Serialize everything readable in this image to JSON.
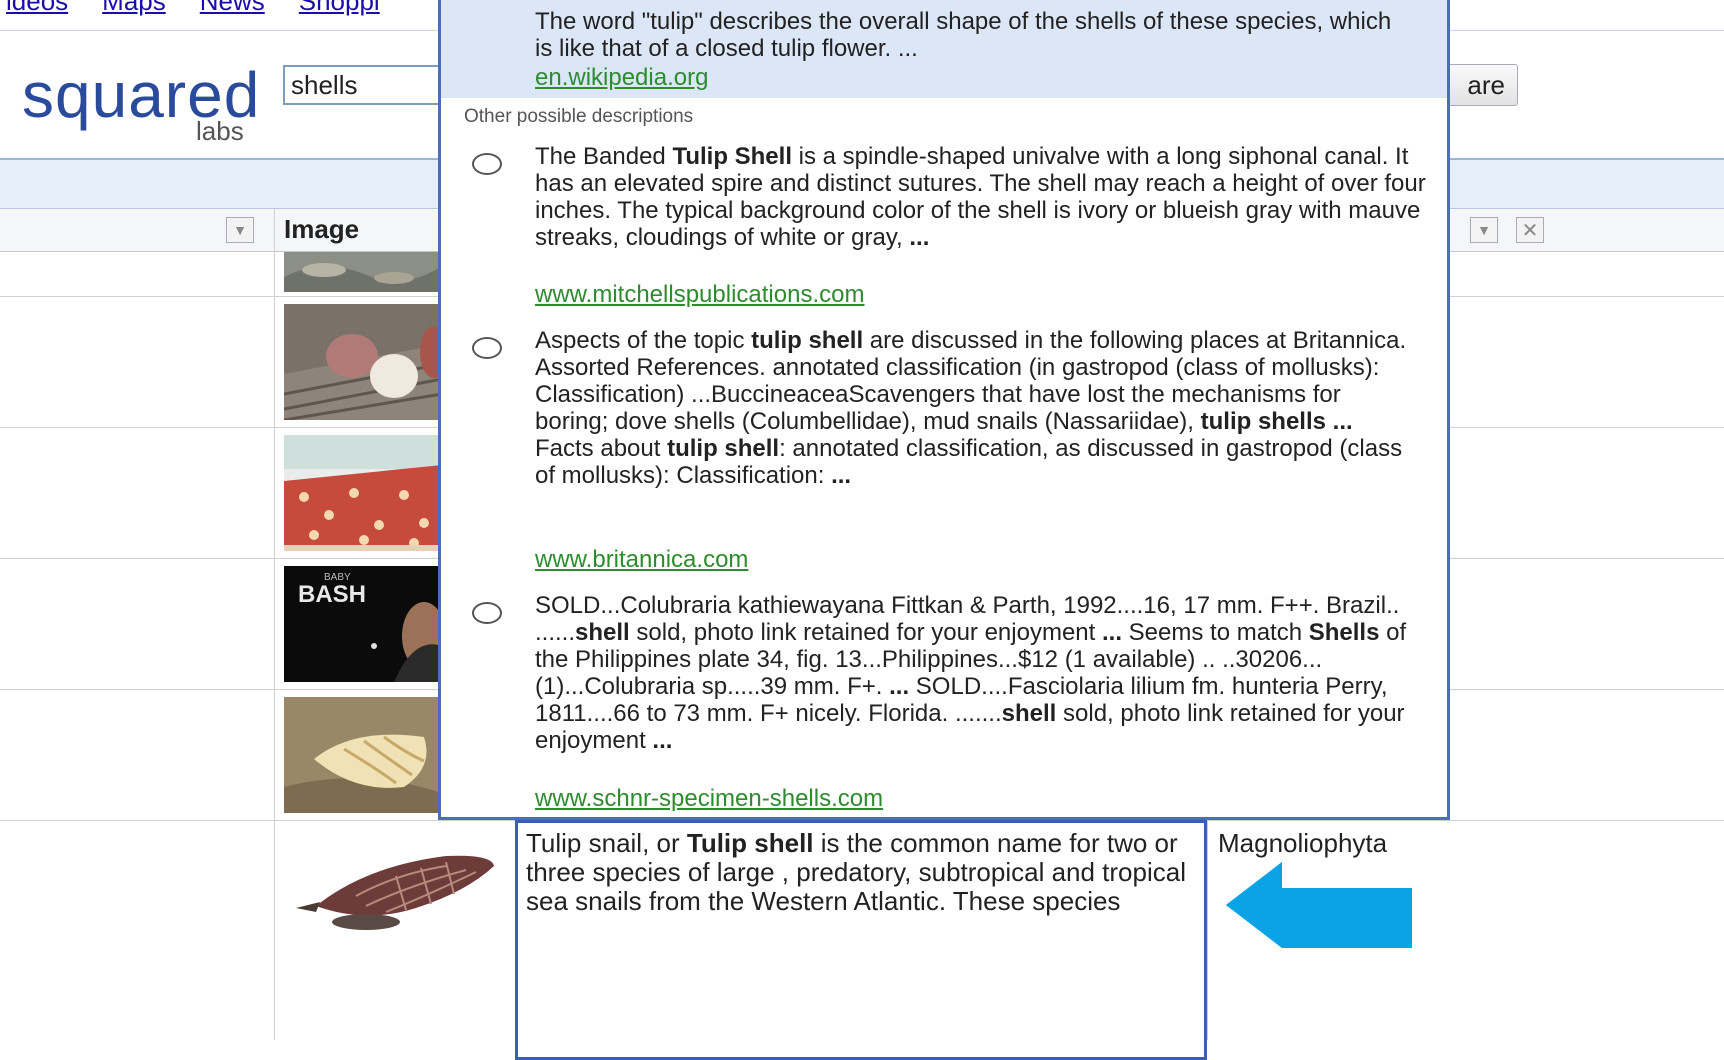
{
  "nav": {
    "links": [
      "ideos",
      "Maps",
      "News",
      "Shoppi"
    ]
  },
  "logo": {
    "main": "squared",
    "sub": "labs"
  },
  "search": {
    "value": "shells",
    "compare_label": "are"
  },
  "table": {
    "column_header_image": "Image"
  },
  "popup": {
    "selected": {
      "text": "The word \"tulip\" describes the overall shape of the shells of these species, which is like that of a closed tulip flower. ...",
      "source": "en.wikipedia.org"
    },
    "other_label": "Other possible descriptions",
    "options": [
      {
        "segments": [
          {
            "t": "The Banded ",
            "b": false
          },
          {
            "t": "Tulip Shell",
            "b": true
          },
          {
            "t": " is a spindle-shaped univalve with a long siphonal canal. It has an elevated spire and distinct sutures. The shell may reach a height of over four inches. The typical background color of the shell is ivory or blueish gray with mauve streaks, cloudings of white or gray, ",
            "b": false
          },
          {
            "t": "...",
            "b": true
          }
        ],
        "source": "www.mitchellspublications.com"
      },
      {
        "segments": [
          {
            "t": "Aspects of the topic ",
            "b": false
          },
          {
            "t": "tulip shell",
            "b": true
          },
          {
            "t": " are discussed in the following places at Britannica. Assorted References. annotated classification (in gastropod (class of mollusks): Classification) ...BuccineaceaScavengers that have lost the mechanisms for boring; dove shells (Columbellidae), mud snails (Nassariidae), ",
            "b": false
          },
          {
            "t": "tulip shells ...",
            "b": true
          },
          {
            "t": " Facts about ",
            "b": false
          },
          {
            "t": "tulip shell",
            "b": true
          },
          {
            "t": ": annotated classification, as discussed in gastropod (class of mollusks): Classification: ",
            "b": false
          },
          {
            "t": "...",
            "b": true
          }
        ],
        "source": "www.britannica.com"
      },
      {
        "segments": [
          {
            "t": "SOLD...Colubraria kathiewayana Fittkan & Parth, 1992....16, 17 mm. F++. Brazil.. ......",
            "b": false
          },
          {
            "t": "shell",
            "b": true
          },
          {
            "t": " sold, photo link retained for your enjoyment ",
            "b": false
          },
          {
            "t": "...",
            "b": true
          },
          {
            "t": " Seems to match ",
            "b": false
          },
          {
            "t": "Shells",
            "b": true
          },
          {
            "t": " of the Philippines plate 34, fig. 13...Philippines...$12 (1 available) .. ..30206... (1)...Colubraria sp.....39 mm. F+. ",
            "b": false
          },
          {
            "t": "...",
            "b": true
          },
          {
            "t": " SOLD....Fasciolaria lilium fm. hunteria Perry, 1811....66 to 73 mm. F+ nicely. Florida. .......",
            "b": false
          },
          {
            "t": "shell",
            "b": true
          },
          {
            "t": " sold, photo link retained for your enjoyment ",
            "b": false
          },
          {
            "t": "...",
            "b": true
          }
        ],
        "source": "www.schnr-specimen-shells.com"
      }
    ]
  },
  "bottom_row": {
    "description_segments": [
      {
        "t": "Tulip snail, or ",
        "b": false
      },
      {
        "t": "Tulip shell",
        "b": true
      },
      {
        "t": " is the common name for two or three species of large , predatory, subtropical and tropical sea snails from the Western Atlantic. These species",
        "b": false
      }
    ],
    "classification": "Magnoliophyta"
  },
  "colors": {
    "popup_border": "#4a6fb8",
    "selected_bg": "#dbe6f7",
    "link_green": "#2e8b2e",
    "arrow": "#0aa3e6"
  }
}
